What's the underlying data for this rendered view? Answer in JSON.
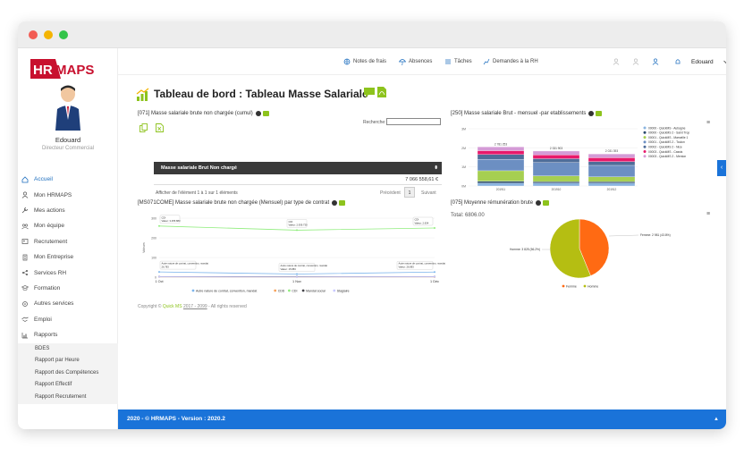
{
  "brand": {
    "logo_hr": "HR",
    "logo_maps": "MAPS"
  },
  "user": {
    "name": "Edouard",
    "role": "Directeur Commercial"
  },
  "nav": {
    "items": [
      {
        "label": "Accueil",
        "icon": "home-icon"
      },
      {
        "label": "Mon HRMAPS",
        "icon": "user-icon"
      },
      {
        "label": "Mes actions",
        "icon": "wrench-icon"
      },
      {
        "label": "Mon équipe",
        "icon": "team-icon"
      },
      {
        "label": "Recrutement",
        "icon": "recruit-icon"
      },
      {
        "label": "Mon Entreprise",
        "icon": "building-icon"
      },
      {
        "label": "Services RH",
        "icon": "share-icon"
      },
      {
        "label": "Formation",
        "icon": "formation-icon"
      },
      {
        "label": "Autres services",
        "icon": "services-icon"
      },
      {
        "label": "Emploi",
        "icon": "handshake-icon"
      },
      {
        "label": "Rapports",
        "icon": "chart-icon"
      }
    ],
    "sub_items": [
      "BDES",
      "Rapport par Heure",
      "Rapport des Compétences",
      "Rapport Effectif",
      "Rapport Recrutement"
    ]
  },
  "topbar": {
    "notes": "Notes de frais",
    "absences": "Absences",
    "taches": "Tâches",
    "demandes": "Demandes à la RH",
    "user": "Edouard"
  },
  "page": {
    "title": "Tableau de bord : Tableau Masse Salariale"
  },
  "panel071": {
    "title": "[071] Masse salariale brute non chargée (cumul)",
    "search_label": "Recherche:",
    "column": "Masse salariale Brut Non chargé",
    "value": "7 066 558,61 €",
    "info": "Afficher de l'élément 1 à 1 sur 1 éléments",
    "prev": "Précédent",
    "page": "1",
    "next": "Suivant"
  },
  "panel250": {
    "title": "[250] Masse salariale Brut - mensuel -par etablissements"
  },
  "panelMS071": {
    "title": "[MS071COME] Masse salariale brute non chargée (Mensuel) par type de contrat"
  },
  "panel075": {
    "title": "[075] Moyenne rémunération brute",
    "total": "Total: 6806.00"
  },
  "copyright": {
    "prefix": "Copyright ©",
    "brand": "Quick MS",
    "years": "2017 - 2099",
    "suffix": "- All rights reserved"
  },
  "footer": {
    "text": "2020 - © HRMAPS - Version : 2020.2"
  },
  "colors": {
    "accent": "#1a73d9",
    "green": "#8dc31d",
    "logo_red": "#c8102e",
    "pie_orange": "#ff6a13",
    "pie_olive": "#b5be12"
  },
  "chart_data": [
    {
      "type": "bar",
      "title": "[250] Masse salariale Brut - mensuel -par etablissements",
      "categories": [
        "201911",
        "201910",
        "201912"
      ],
      "totals": [
        "2 781 253",
        "2 331 903",
        "2 031 393"
      ],
      "ylim": [
        0,
        3
      ],
      "yticks": [
        "3M",
        "2M",
        "1M",
        "0M"
      ],
      "series": [
        {
          "name": "00000 - QuickMS - Aubagne",
          "color": "#8ab4e0",
          "values": [
            0.15,
            0.15,
            0.15
          ]
        },
        {
          "name": "00000 - QuickMS 2 - Saint Trop",
          "color": "#2a4a6e",
          "values": [
            0.1,
            0.08,
            0.08
          ]
        },
        {
          "name": "00001 - QuickMS - Marseille 1",
          "color": "#a6cf51",
          "values": [
            0.55,
            0.3,
            0.25
          ]
        },
        {
          "name": "00001 - QuickMS 2 - Toulon",
          "color": "#6c8fc2",
          "values": [
            0.6,
            0.7,
            0.6
          ]
        },
        {
          "name": "00002 - QuickMS 2 - Nice",
          "color": "#4f6d99",
          "values": [
            0.25,
            0.2,
            0.2
          ]
        },
        {
          "name": "00003 - QuickMS - Cassis",
          "color": "#e8196a",
          "values": [
            0.2,
            0.2,
            0.2
          ]
        },
        {
          "name": "00003 - QuickMS 2 - Menton",
          "color": "#d49bd6",
          "values": [
            0.2,
            0.2,
            0.2
          ]
        }
      ]
    },
    {
      "type": "line",
      "title": "[MS071COME] Masse salariale brute non chargée (Mensuel) par type de contrat",
      "ylabel": "Valeurs",
      "categories": [
        "1 Oct",
        "1 Nov",
        "1 Déc"
      ],
      "yticks": [
        "300",
        "200",
        "100",
        "0"
      ],
      "series": [
        {
          "name": "Autre nature de contrat, convention, mandat",
          "color": "#7cb5ec",
          "values": [
            26.8,
            15.8,
            26.2
          ]
        },
        {
          "name": "CDD",
          "color": "#f7a35c",
          "values": [
            1.5,
            1.2,
            1.0
          ]
        },
        {
          "name": "CDI",
          "color": "#90ed7d",
          "values": [
            260.0,
            239.0,
            250.0
          ]
        },
        {
          "name": "Mandat social",
          "color": "#434348",
          "values": [
            3,
            2,
            3
          ]
        },
        {
          "name": "Stagiaire",
          "color": "#c9c9ff",
          "values": [
            2,
            1,
            2
          ]
        }
      ],
      "tooltips": [
        {
          "label": "CDI",
          "value": "Valeur: 3.255.883"
        },
        {
          "label": "CDI",
          "value": "Valeur: 2.939.730"
        },
        {
          "label": "CDI",
          "value": "Valeur: 2.634"
        },
        {
          "label": "Autre nature de contrat, convention, mandat",
          "value": "26.783"
        },
        {
          "label": "Autre nature de contrat, convention, mandat",
          "value": "Valeur: 15.883"
        },
        {
          "label": "Autre nature de contrat, convention, mandat",
          "value": "Valeur: 26.883"
        }
      ]
    },
    {
      "type": "pie",
      "title": "[075] Moyenne rémunération brute",
      "total": "Total: 6806.00",
      "slices": [
        {
          "name": "Femme",
          "value": 2981,
          "percent": "43.8%",
          "color": "#ff6a13",
          "label": "Femme: 2 981 (43.8%)"
        },
        {
          "name": "Homme",
          "value": 3825,
          "percent": "56.2%",
          "color": "#b5be12",
          "label": "Homme: 3 825 (56.2%)"
        }
      ]
    }
  ]
}
